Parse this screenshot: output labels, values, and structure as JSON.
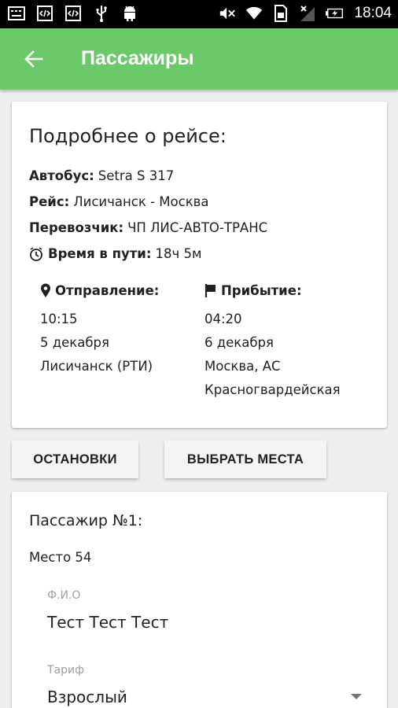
{
  "status_bar": {
    "time": "18:04",
    "left_icons": [
      "keyboard-icon",
      "code-icon",
      "code-icon",
      "usb-icon",
      "android-icon"
    ],
    "right_icons": [
      "mute-icon",
      "wifi-icon",
      "sim-icon",
      "no-signal-icon",
      "battery-icon"
    ]
  },
  "appbar": {
    "title": "Пассажиры",
    "back_icon": "arrow-back-icon",
    "color": "#6cc96a"
  },
  "trip": {
    "title": "Подробнее о рейсе:",
    "bus_label": "Автобус:",
    "bus_value": "Setra S 317",
    "route_label": "Рейс:",
    "route_value": "Лисичанск - Москва",
    "carrier_label": "Перевозчик:",
    "carrier_value": "ЧП ЛИС-АВТО-ТРАНС",
    "duration_label": "Время в пути:",
    "duration_value": "18ч 5м",
    "departure": {
      "label": "Отправление:",
      "time": "10:15",
      "date": "5 декабря",
      "place": "Лисичанск (РТИ)"
    },
    "arrival": {
      "label": "Прибытие:",
      "time": "04:20",
      "date": "6 декабря",
      "place_line1": "Москва, АС",
      "place_line2": "Красногвардейская"
    }
  },
  "buttons": {
    "stops": "ОСТАНОВКИ",
    "seats": "ВЫБРАТЬ МЕСТА"
  },
  "passenger": {
    "title": "Пассажир №1:",
    "seat": "Место 54",
    "fio_label": "Ф.И.О",
    "fio_value": "Тест Тест Тест",
    "tariff_label": "Тариф",
    "tariff_value": "Взрослый"
  }
}
